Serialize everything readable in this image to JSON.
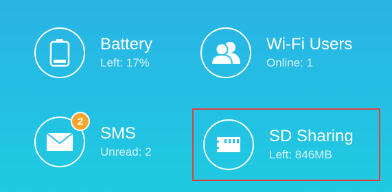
{
  "colors": {
    "background_top": "#2ab3e6",
    "background_bottom": "#1fcbe0",
    "badge": "#f7a52b",
    "highlight_border": "#e0403a"
  },
  "tiles": {
    "battery": {
      "icon": "battery-icon",
      "title": "Battery",
      "subtitle": "Left: 17%",
      "level": 0.17
    },
    "wifi_users": {
      "icon": "users-icon",
      "title": "Wi-Fi Users",
      "subtitle": "Online: 1"
    },
    "sms": {
      "icon": "envelope-icon",
      "title": "SMS",
      "subtitle": "Unread: 2",
      "badge": "2"
    },
    "sd_sharing": {
      "icon": "sd-card-icon",
      "title": "SD Sharing",
      "subtitle": "Left: 846MB",
      "highlighted": true
    }
  }
}
